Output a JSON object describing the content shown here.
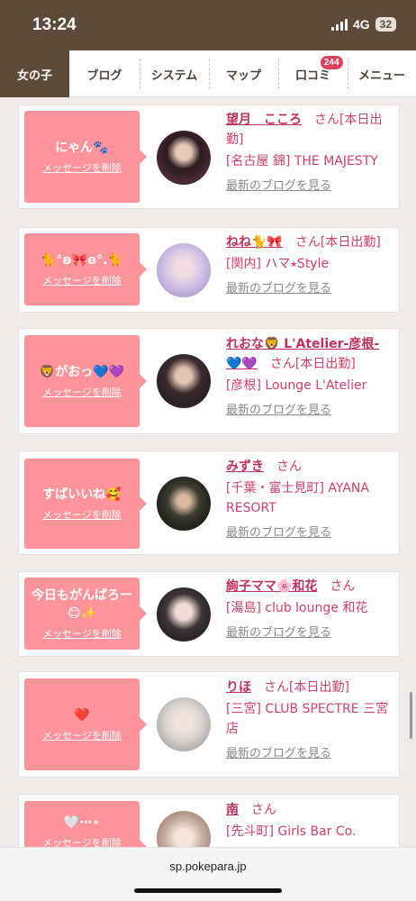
{
  "status": {
    "time": "13:24",
    "network": "4G",
    "battery": "32"
  },
  "nav": {
    "tabs": [
      "女の子",
      "ブログ",
      "システム",
      "マップ",
      "口コミ",
      "メニュー"
    ],
    "badge": "244"
  },
  "delete_label": "メッセージを削除",
  "blog_label": "最新のブログを見る",
  "cards": [
    {
      "message": "にゃん🐾",
      "name": "望月　こころ",
      "san": "さん",
      "status": "[本日出勤]",
      "shop": "[名古屋 錦] THE MAJESTY"
    },
    {
      "message": "🐈°ʚ🎀ɞ°.🐈",
      "name": "ねね🐈🎀",
      "san": "さん",
      "status": "[本日出勤]",
      "shop": "[関内] ハマ⭑Style"
    },
    {
      "message": "🦁がおっ💙💜",
      "name": "れおな🦁 L'Atelier-彦根-💙💜",
      "san": "さん",
      "status": "[本日出勤]",
      "shop": "[彦根] Lounge L'Atelier"
    },
    {
      "message": "すばいいね🥰",
      "name": "みずき",
      "san": "さん",
      "status": "",
      "shop": "[千葉・富士見町] AYANA RESORT"
    },
    {
      "message": "今日もがんばろー😊✨",
      "name": "絢子ママ🌸和花",
      "san": "さん",
      "status": "",
      "shop": "[湯島] club lounge 和花"
    },
    {
      "message": "❤️",
      "name": "りほ",
      "san": "さん",
      "status": "[本日出勤]",
      "shop": "[三宮] CLUB SPECTRE 三宮店"
    },
    {
      "message": "🤍⋯⋆",
      "name": "南",
      "san": "さん",
      "status": "",
      "shop": "[先斗町] Girls Bar Co."
    }
  ],
  "url": "sp.pokepara.jp"
}
